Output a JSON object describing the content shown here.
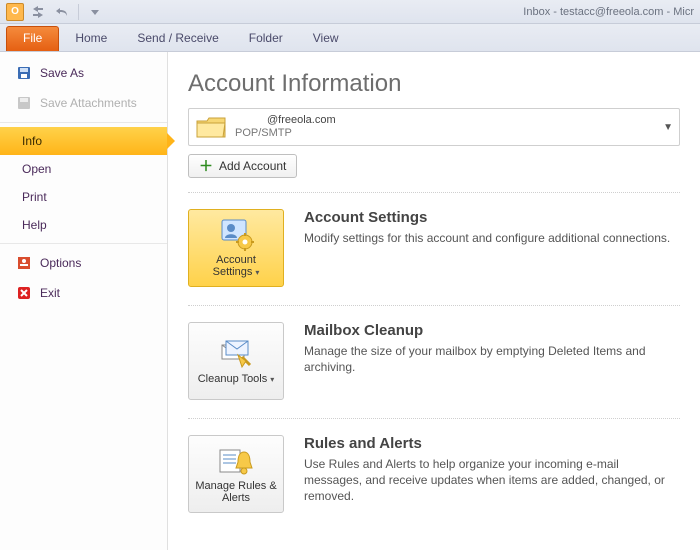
{
  "window_title": "Inbox - testacc@freeola.com - Micr",
  "ribbon": {
    "file": "File",
    "tabs": [
      "Home",
      "Send / Receive",
      "Folder",
      "View"
    ]
  },
  "backstage_nav": {
    "save_as": "Save As",
    "save_attachments": "Save Attachments",
    "info": "Info",
    "open": "Open",
    "print": "Print",
    "help": "Help",
    "options": "Options",
    "exit": "Exit"
  },
  "page_title": "Account Information",
  "account": {
    "email": "@freeola.com",
    "protocol": "POP/SMTP"
  },
  "add_account": "Add Account",
  "sections": {
    "settings": {
      "button": "Account Settings",
      "title": "Account Settings",
      "desc": "Modify settings for this account and configure additional connections."
    },
    "cleanup": {
      "button": "Cleanup Tools",
      "title": "Mailbox Cleanup",
      "desc": "Manage the size of your mailbox by emptying Deleted Items and archiving."
    },
    "rules": {
      "button": "Manage Rules & Alerts",
      "title": "Rules and Alerts",
      "desc": "Use Rules and Alerts to help organize your incoming e-mail messages, and receive updates when items are added, changed, or removed."
    }
  }
}
